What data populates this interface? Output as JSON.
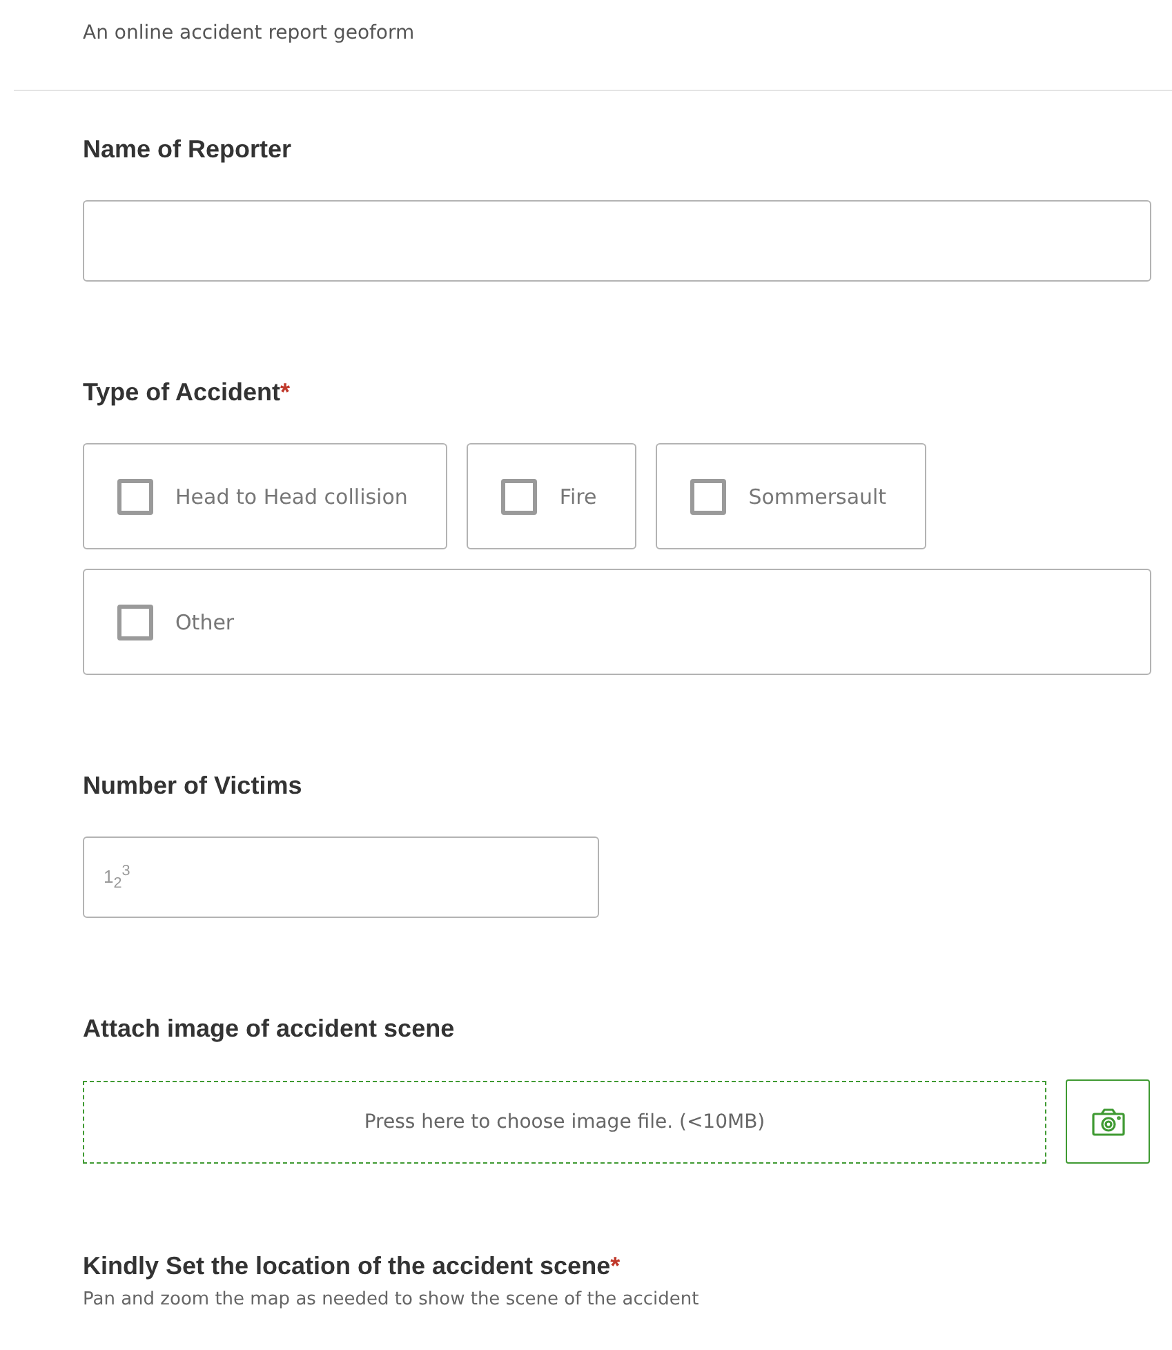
{
  "description": "An online accident report geoform",
  "fields": [
    {
      "kind": "text",
      "label": "Name of Reporter"
    },
    {
      "kind": "checkboxes",
      "label": "Type of Accident",
      "required_mark": "*",
      "options": [
        {
          "label": "Head to Head collision",
          "checked": false
        },
        {
          "label": "Fire",
          "checked": false
        },
        {
          "label": "Sommersault",
          "checked": false
        },
        {
          "label": "Other",
          "checked": false
        }
      ]
    },
    {
      "kind": "number",
      "label": "Number of Victims",
      "icon_text": "1$_{2}$$^{3}$"
    },
    {
      "kind": "file",
      "label": "Attach image of accident scene",
      "prompt": "Press here to choose image file. (<10MB)"
    },
    {
      "kind": "location",
      "label": "Kindly Set the location of the accident scene",
      "required_mark": "*",
      "hint": "Pan and zoom the map as needed to show the scene of the accident"
    }
  ]
}
